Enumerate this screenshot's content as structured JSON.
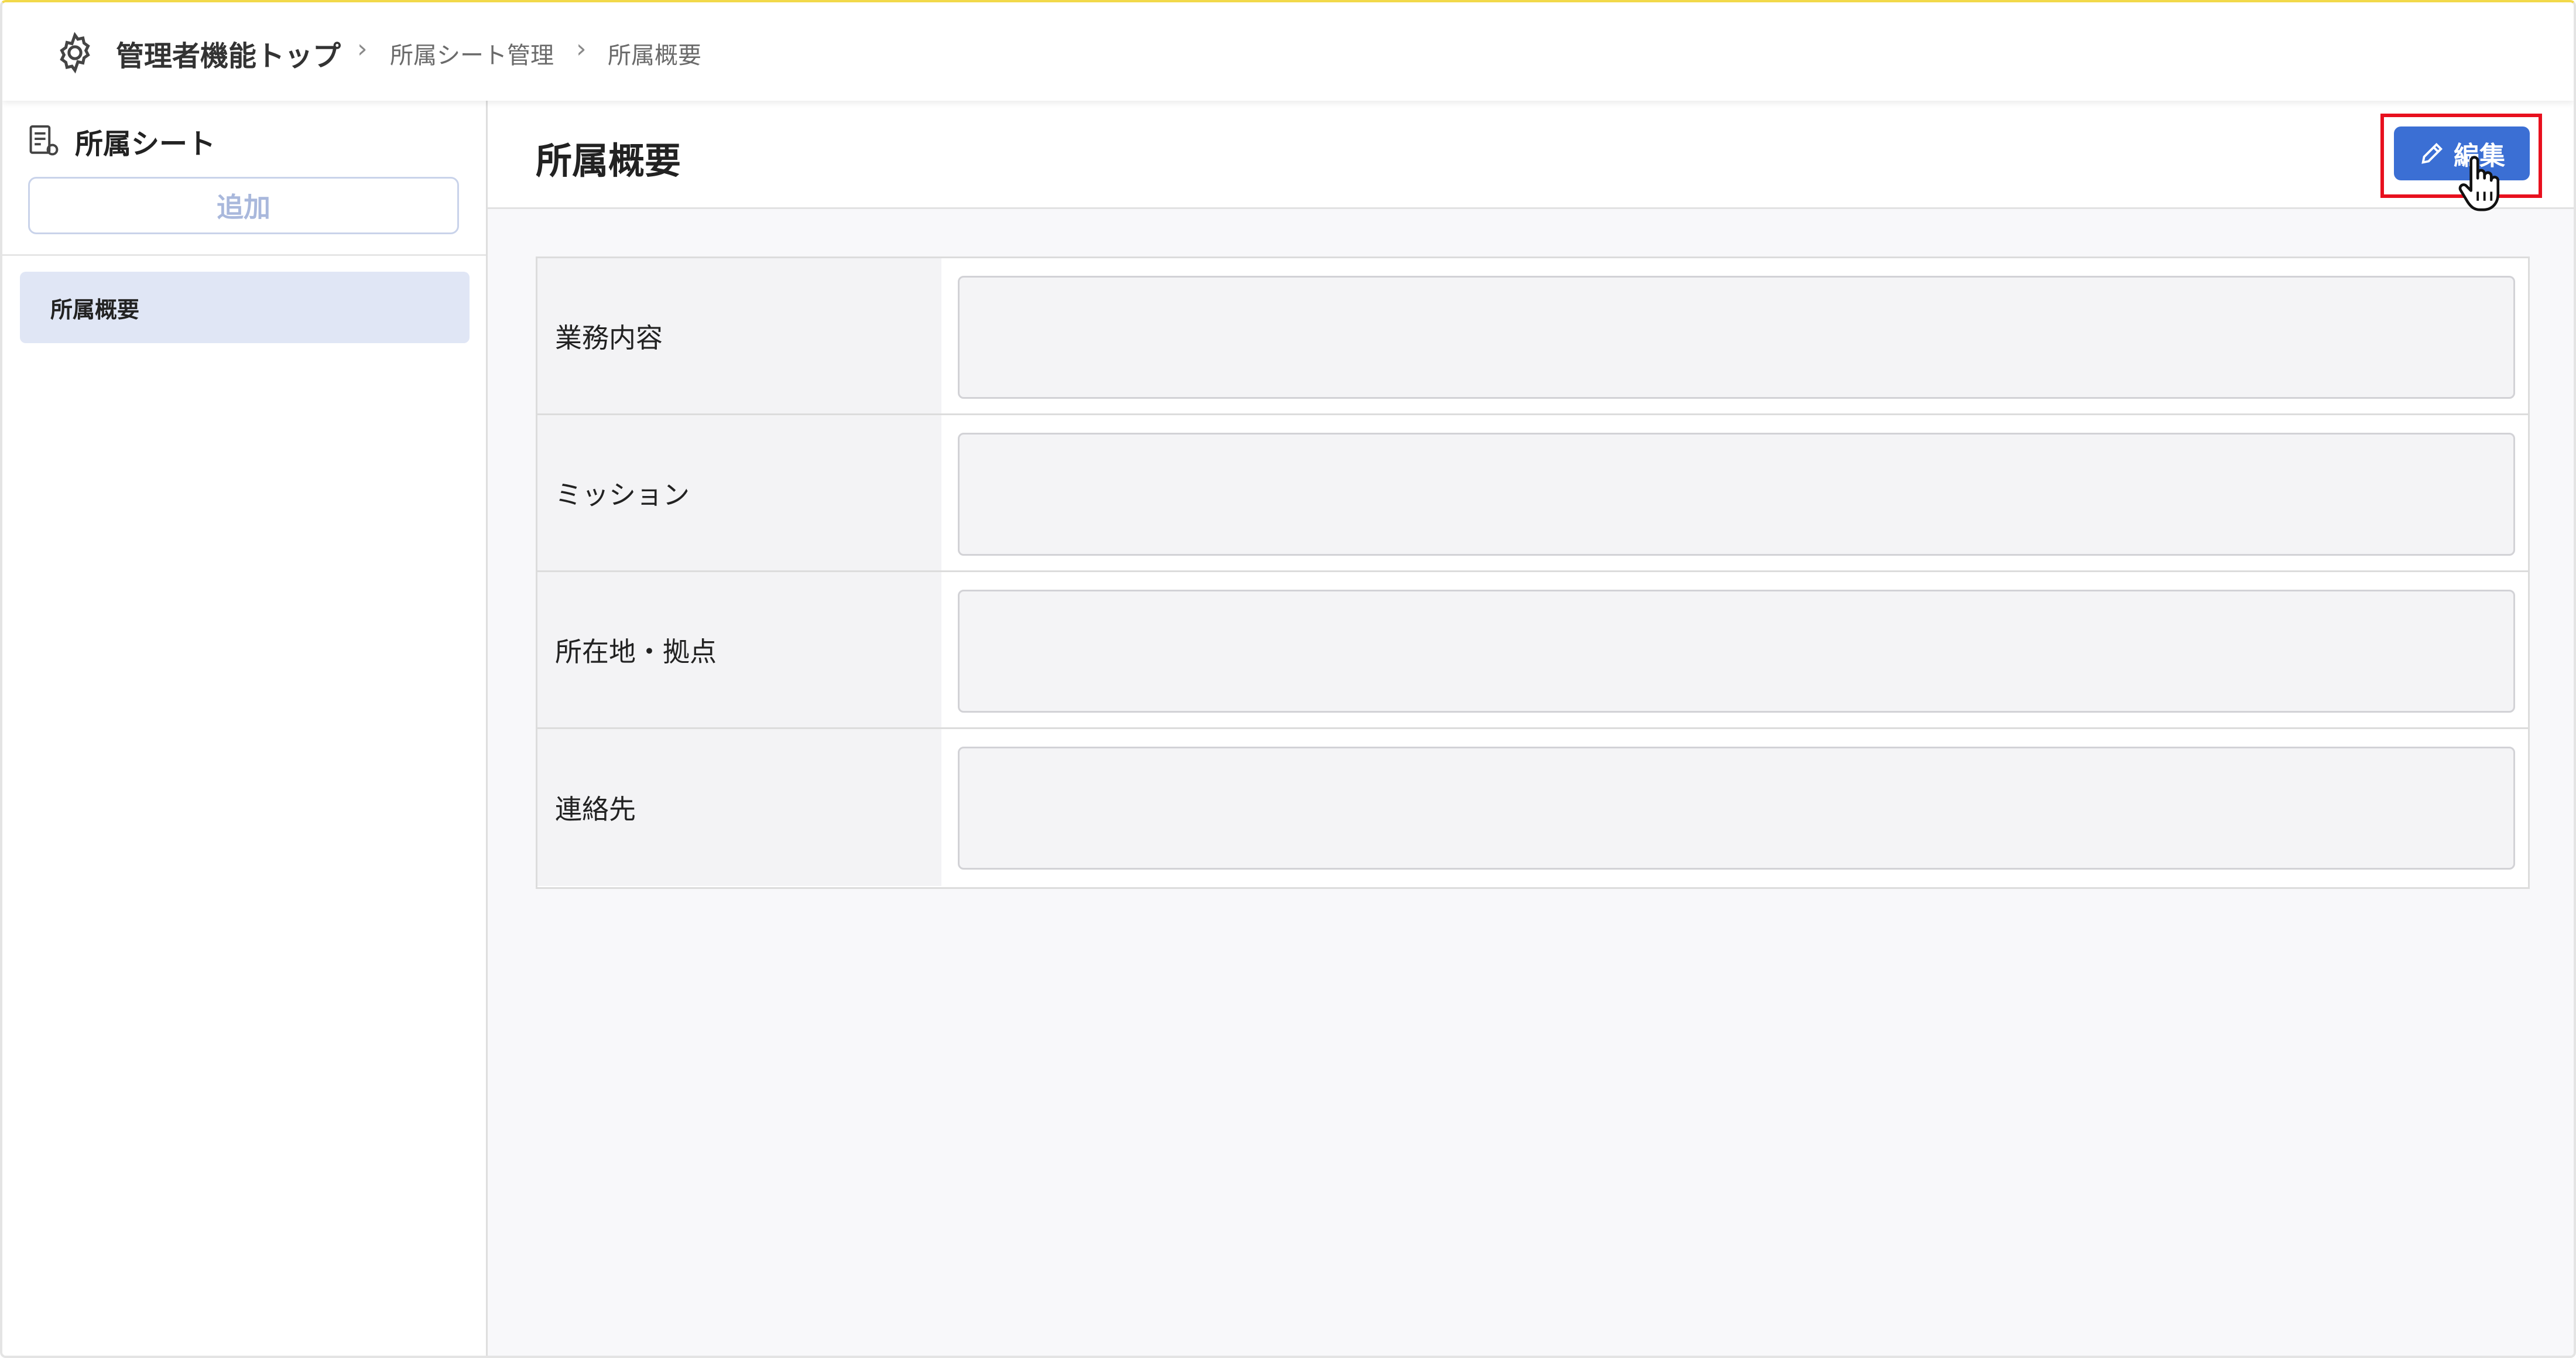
{
  "breadcrumb": {
    "home": "管理者機能トップ",
    "items": [
      "所属シート管理",
      "所属概要"
    ]
  },
  "sidebar": {
    "title": "所属シート",
    "add_label": "追加",
    "items": [
      {
        "label": "所属概要"
      }
    ]
  },
  "main": {
    "title": "所属概要",
    "edit_label": "編集",
    "fields": [
      {
        "label": "業務内容",
        "value": ""
      },
      {
        "label": "ミッション",
        "value": ""
      },
      {
        "label": "所在地・拠点",
        "value": ""
      },
      {
        "label": "連絡先",
        "value": ""
      }
    ]
  },
  "colors": {
    "accent": "#3b6fd4",
    "highlight": "#e8101e",
    "selected_bg": "#e0e6f5"
  },
  "icons": [
    "gear-icon",
    "sheet-icon",
    "pencil-icon",
    "hand-cursor-icon",
    "chevron-right-icon"
  ]
}
